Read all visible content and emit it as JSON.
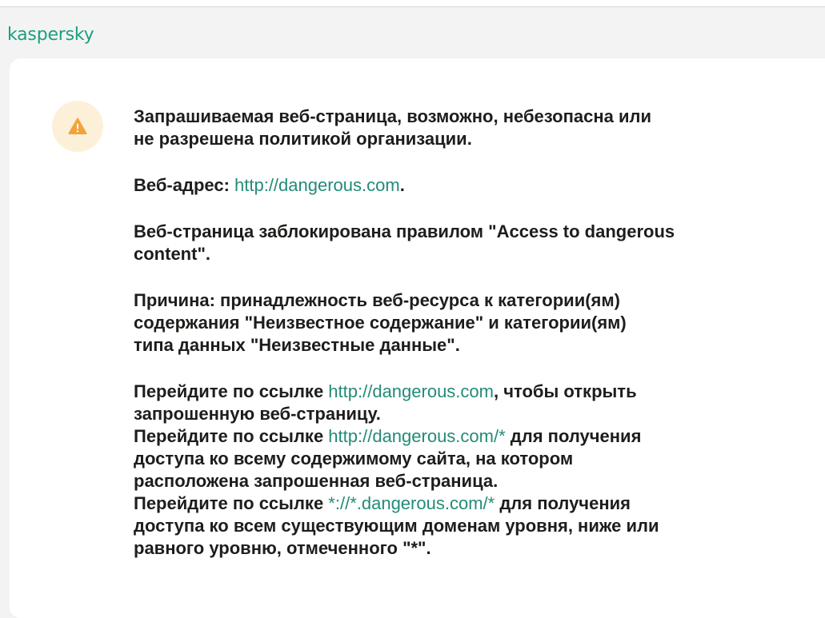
{
  "brand": {
    "logo_text": "kaspersky",
    "accent": "#1aa07f",
    "link_color": "#238b77",
    "warning_color": "#f2a43a"
  },
  "icon": "warning-icon",
  "message": {
    "headline_1": "Запрашиваемая веб-страница, возможно, небезопасна или",
    "headline_2": "не разрешена политикой организации.",
    "address_label": "Веб-адрес: ",
    "address_link": "http://dangerous.com",
    "address_end": ".",
    "rule_1": "Веб-страница заблокирована правилом \"Access to dangerous",
    "rule_2": "content\".",
    "reason_1": "Причина: принадлежность веб-ресурса к категории(ям)",
    "reason_2": "содержания \"Неизвестное содержание\" и категории(ям)",
    "reason_3": "типа данных \"Неизвестные данные\".",
    "go1_prefix": "Перейдите по ссылке ",
    "go1_link": "http://dangerous.com",
    "go1_suffix": ", чтобы открыть",
    "go1_line2": "запрошенную веб-страницу.",
    "go2_prefix": "Перейдите по ссылке ",
    "go2_link": "http://dangerous.com/*",
    "go2_suffix": " для получения",
    "go2_line2": "доступа ко всему содержимому сайта, на котором",
    "go2_line3": "расположена запрошенная веб-страница.",
    "go3_prefix": "Перейдите по ссылке ",
    "go3_link": "*://*.dangerous.com/*",
    "go3_suffix": " для получения",
    "go3_line2": "доступа ко всем существующим доменам уровня, ниже или",
    "go3_line3": "равного уровню, отмеченного \"*\"."
  }
}
